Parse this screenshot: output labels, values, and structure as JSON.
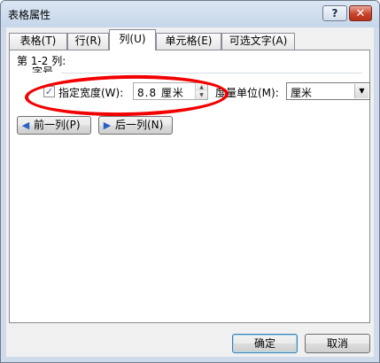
{
  "window": {
    "title": "表格属性",
    "help_label": "?",
    "close_label": "✕"
  },
  "tabs": [
    {
      "label": "表格(T)",
      "active": false
    },
    {
      "label": "行(R)",
      "active": false
    },
    {
      "label": "列(U)",
      "active": true
    },
    {
      "label": "单元格(E)",
      "active": false
    },
    {
      "label": "可选文字(A)",
      "active": false
    }
  ],
  "column_panel": {
    "columns_label": "第 1-2 列:",
    "size_group_label": "字号",
    "specify_width_label": "指定宽度(W):",
    "specify_width_checked": true,
    "width_value": "8.8 厘米",
    "unit_label": "度量单位(M):",
    "unit_selected": "厘米",
    "prev_column_label": "前一列(P)",
    "next_column_label": "后一列(N)"
  },
  "footer": {
    "ok_label": "确定",
    "cancel_label": "取消"
  },
  "icons": {
    "prev": "arrow-left-icon",
    "next": "arrow-right-icon",
    "check": "checkmark-icon",
    "dropdown": "chevron-down-icon"
  },
  "colors": {
    "annotation": "#f20000",
    "titlebar": "#c6d6ea",
    "close_button": "#c7432b"
  }
}
